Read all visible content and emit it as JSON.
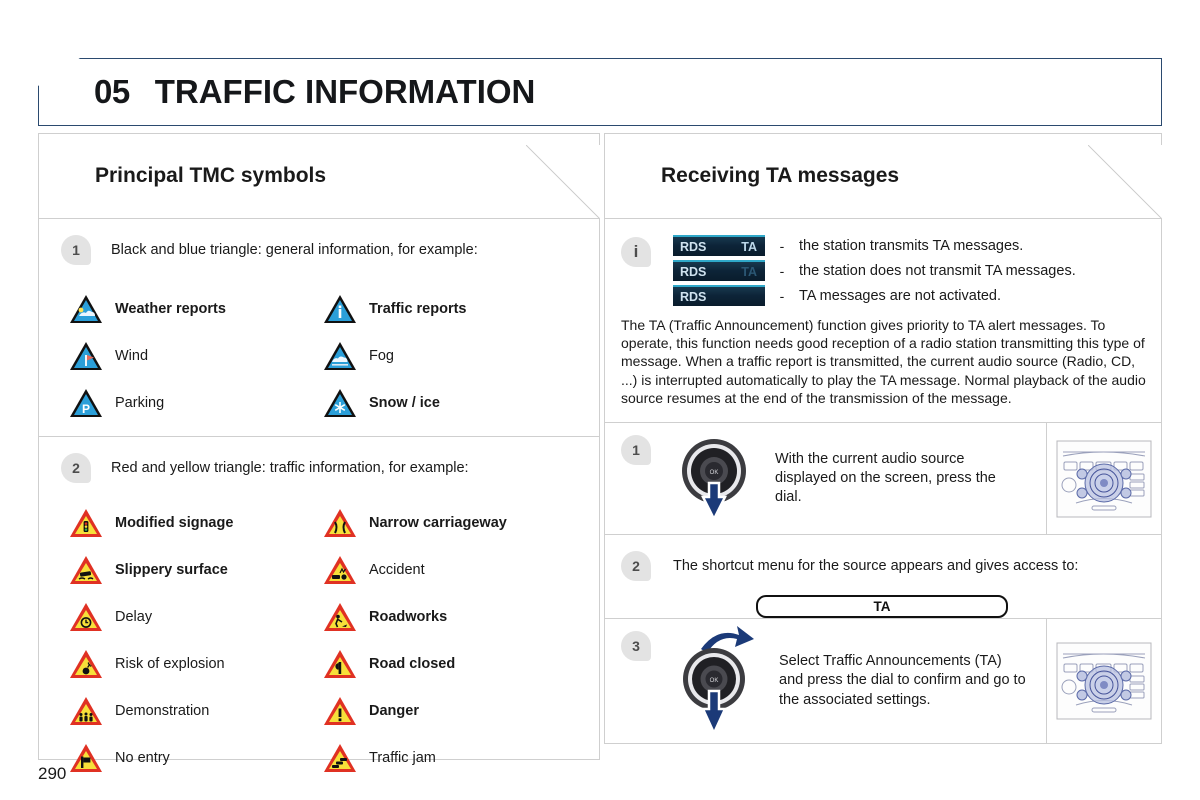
{
  "header": {
    "chapter_number": "05",
    "chapter_title": "TRAFFIC INFORMATION"
  },
  "page_number": "290",
  "left_column": {
    "section_title": "Principal TMC symbols",
    "group1": {
      "badge": "1",
      "caption": "Black and blue triangle: general information, for example:",
      "symbols": [
        {
          "label": "Weather reports",
          "bold": true,
          "icon": "blue-triangle-weather-icon"
        },
        {
          "label": "Traffic reports",
          "bold": true,
          "icon": "blue-triangle-info-icon"
        },
        {
          "label": "Wind",
          "bold": false,
          "icon": "blue-triangle-wind-icon"
        },
        {
          "label": "Fog",
          "bold": false,
          "icon": "blue-triangle-fog-icon"
        },
        {
          "label": "Parking",
          "bold": false,
          "icon": "blue-triangle-parking-icon"
        },
        {
          "label": "Snow / ice",
          "bold": true,
          "icon": "blue-triangle-snow-icon"
        }
      ]
    },
    "group2": {
      "badge": "2",
      "caption": "Red and yellow triangle: traffic information, for example:",
      "symbols": [
        {
          "label": "Modified signage",
          "bold": true,
          "icon": "warning-triangle-trafficlight-icon"
        },
        {
          "label": "Narrow carriageway",
          "bold": true,
          "icon": "warning-triangle-narrow-icon"
        },
        {
          "label": "Slippery surface",
          "bold": true,
          "icon": "warning-triangle-slippery-icon"
        },
        {
          "label": "Accident",
          "bold": false,
          "icon": "warning-triangle-accident-icon"
        },
        {
          "label": "Delay",
          "bold": false,
          "icon": "warning-triangle-delay-icon"
        },
        {
          "label": "Roadworks",
          "bold": true,
          "icon": "warning-triangle-roadworks-icon"
        },
        {
          "label": "Risk of explosion",
          "bold": false,
          "icon": "warning-triangle-explosion-icon"
        },
        {
          "label": "Road closed",
          "bold": true,
          "icon": "warning-triangle-roadclosed-icon"
        },
        {
          "label": "Demonstration",
          "bold": false,
          "icon": "warning-triangle-demonstration-icon"
        },
        {
          "label": "Danger",
          "bold": true,
          "icon": "warning-triangle-danger-icon"
        },
        {
          "label": "No entry",
          "bold": false,
          "icon": "warning-triangle-noentry-icon"
        },
        {
          "label": "Traffic jam",
          "bold": false,
          "icon": "warning-triangle-trafficjam-icon"
        }
      ]
    }
  },
  "right_column": {
    "section_title": "Receiving TA messages",
    "info_block": {
      "badge": "i",
      "indicators": [
        {
          "rds": "RDS",
          "ta": "TA",
          "ta_active": true,
          "dash": "-",
          "text": "the station transmits TA messages."
        },
        {
          "rds": "RDS",
          "ta": "TA",
          "ta_active": false,
          "dash": "-",
          "text": "the station does not transmit TA messages."
        },
        {
          "rds": "RDS",
          "ta": "",
          "ta_active": false,
          "dash": "-",
          "text": "TA messages are not activated."
        }
      ],
      "paragraph": "The TA (Traffic Announcement) function gives priority to TA alert messages. To operate, this function needs good reception of a radio station transmitting this type of message. When a traffic report is transmitted, the current audio source (Radio, CD, ...) is interrupted automatically to play the TA message. Normal playback of the audio source resumes at the end of the transmission of the message."
    },
    "steps": [
      {
        "badge": "1",
        "text": "With the current audio source displayed on the screen, press the dial.",
        "dial_icon": "dial-press-icon",
        "panel_icon": "radio-control-panel-icon"
      },
      {
        "badge": "2",
        "text": "The shortcut menu for the source appears and gives access to:",
        "pill_label": "TA"
      },
      {
        "badge": "3",
        "text": "Select Traffic Announcements (TA) and press the dial to confirm and go to the associated settings.",
        "dial_icon": "dial-turn-press-icon",
        "panel_icon": "radio-control-panel-icon"
      }
    ]
  },
  "colors": {
    "header_border": "#2b4a6f",
    "panel_border": "#cfcfcf",
    "badge_bg": "#e3e3e3",
    "blue_triangle": "#2b9fd9",
    "warn_red": "#e03123",
    "warn_yellow": "#f7e03a",
    "rds_screen": "#0d2438",
    "dial_arrow": "#1b3a78"
  }
}
